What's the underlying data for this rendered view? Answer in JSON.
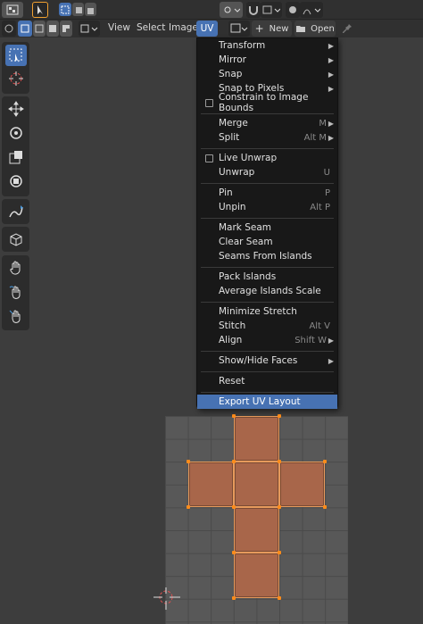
{
  "header": {
    "menus": [
      "View",
      "Select",
      "Image"
    ],
    "uv_tab": "UV",
    "new_label": "New",
    "open_label": "Open"
  },
  "uv_menu": {
    "items": [
      {
        "label": "Transform",
        "submenu": true
      },
      {
        "label": "Mirror",
        "submenu": true
      },
      {
        "label": "Snap",
        "submenu": true
      },
      {
        "label": "Snap to Pixels",
        "submenu": true
      },
      {
        "label": "Constrain to Image Bounds",
        "checkbox": true
      },
      {
        "label": "Merge",
        "shortcut": "M"
      },
      {
        "label": "Split",
        "shortcut": "Alt M"
      },
      {
        "label": "Live Unwrap",
        "checkbox": true
      },
      {
        "label": "Unwrap",
        "shortcut": "U"
      },
      {
        "label": "Pin",
        "shortcut": "P"
      },
      {
        "label": "Unpin",
        "shortcut": "Alt P"
      },
      {
        "label": "Mark Seam"
      },
      {
        "label": "Clear Seam"
      },
      {
        "label": "Seams From Islands"
      },
      {
        "label": "Pack Islands"
      },
      {
        "label": "Average Islands Scale"
      },
      {
        "label": "Minimize Stretch"
      },
      {
        "label": "Stitch",
        "shortcut": "Alt V"
      },
      {
        "label": "Align",
        "shortcut": "Shift W"
      },
      {
        "label": "Show/Hide Faces",
        "submenu": true
      },
      {
        "label": "Reset"
      },
      {
        "label": "Export UV Layout",
        "highlighted": true
      }
    ]
  },
  "colors": {
    "accent": "#4772b3",
    "uv_face": "#a8664a",
    "uv_vertex": "#ff8c1a"
  }
}
